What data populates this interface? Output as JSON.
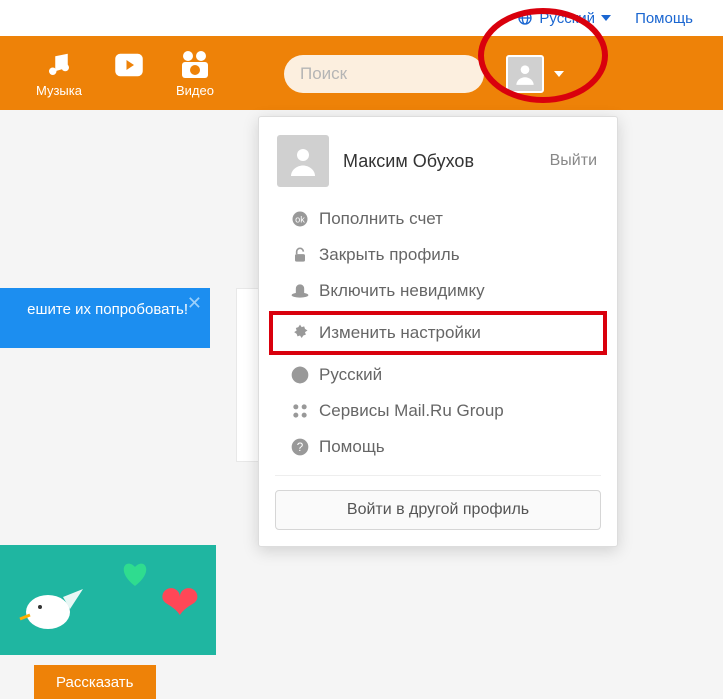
{
  "topbar": {
    "language_label": "Русский",
    "help_label": "Помощь"
  },
  "header": {
    "nav": {
      "music": "Музыка",
      "video": "Видео"
    },
    "search_placeholder": "Поиск"
  },
  "dropdown": {
    "username": "Максим Обухов",
    "logout_label": "Выйти",
    "items": {
      "topup": "Пополнить счет",
      "lock": "Закрыть профиль",
      "invisible": "Включить невидимку",
      "settings": "Изменить настройки",
      "language": "Русский",
      "services": "Сервисы Mail.Ru Group",
      "help": "Помощь"
    },
    "other_profile_btn": "Войти в другой профиль"
  },
  "blue_banner": {
    "text": "ешите их попробовать!"
  },
  "tell_button": "Рассказать"
}
